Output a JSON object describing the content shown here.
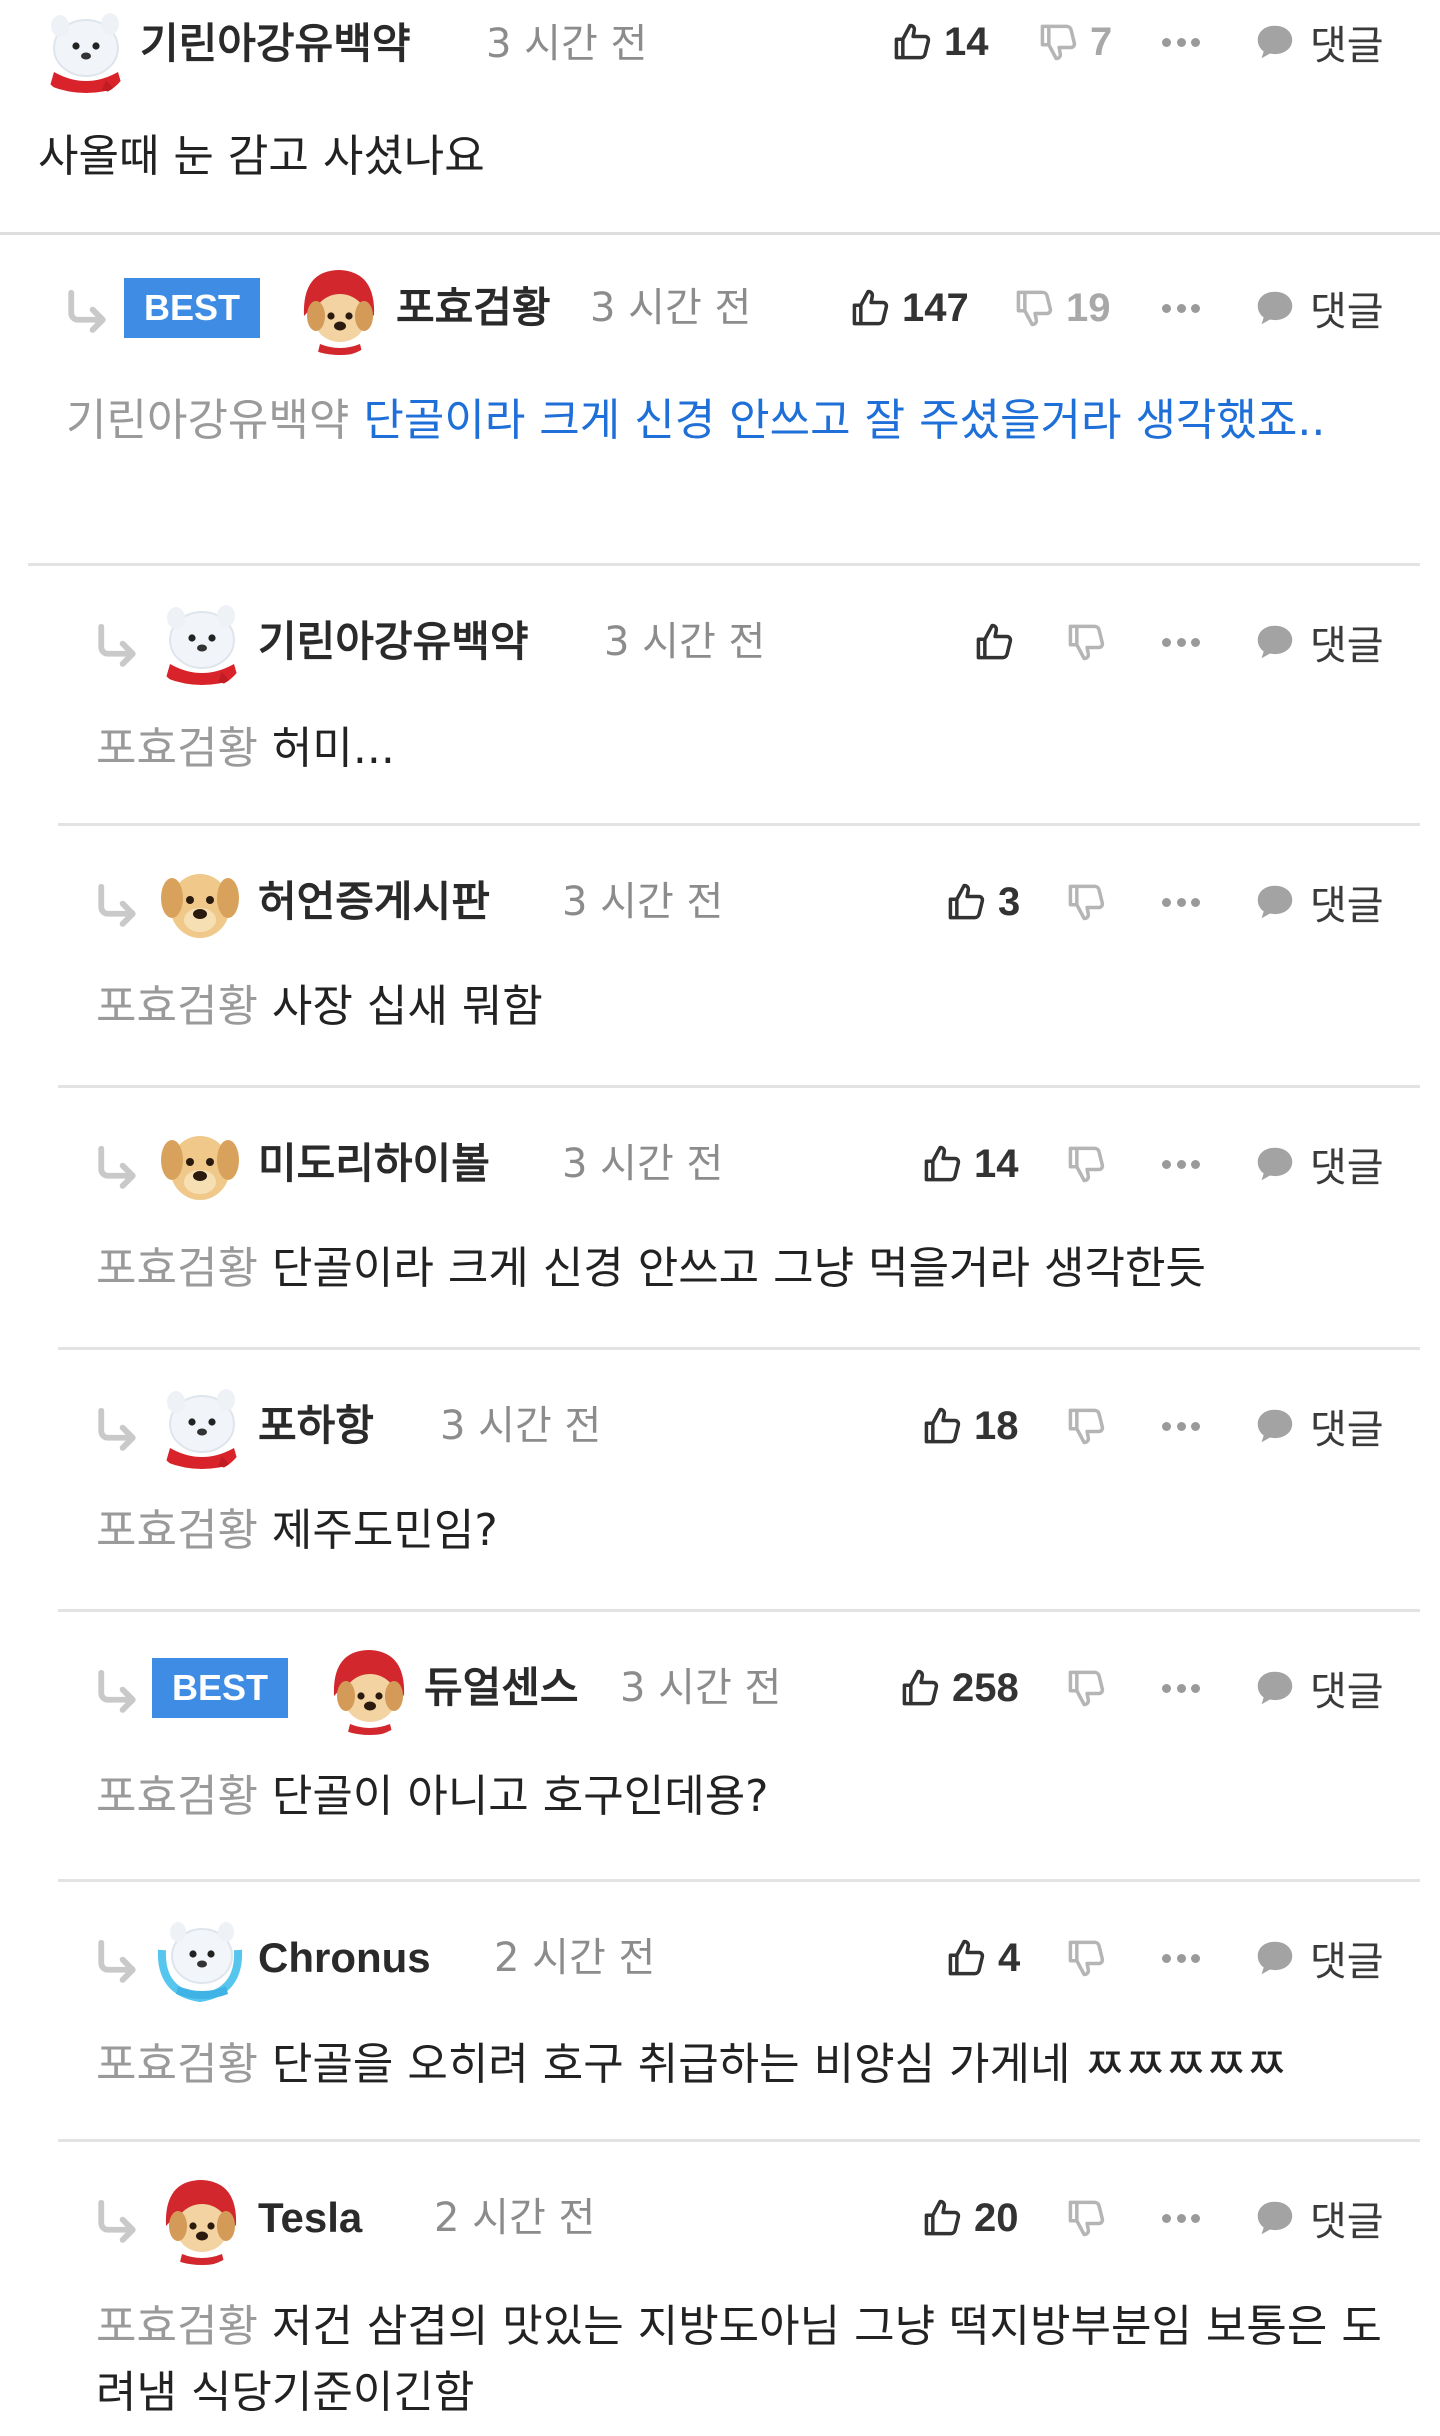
{
  "colors": {
    "best_badge": "#3f8ce5",
    "highlight_text": "#1f6fd9",
    "mention": "#9a9a9a"
  },
  "labels": {
    "reply": "댓글",
    "best": "BEST"
  },
  "comments": [
    {
      "nick": "기린아강유백약",
      "time": "3 시간 전",
      "likes": "14",
      "dislikes": "7",
      "mention": "",
      "text": "사올때 눈 감고 사셨나요",
      "avatar": "white-dog"
    },
    {
      "nick": "포효검황",
      "time": "3 시간 전",
      "likes": "147",
      "dislikes": "19",
      "mention": "기린아강유백약",
      "text": "단골이라 크게 신경 안쓰고 잘 주셨을거라 생각했죠..",
      "avatar": "red-hood-dog",
      "best": true
    },
    {
      "nick": "기린아강유백약",
      "time": "3 시간 전",
      "likes": "",
      "dislikes": "",
      "mention": "포효검황",
      "text": "허미...",
      "avatar": "white-dog"
    },
    {
      "nick": "허언증게시판",
      "time": "3 시간 전",
      "likes": "3",
      "dislikes": "",
      "mention": "포효검황",
      "text": "사장 십새 뭐함",
      "avatar": "puppy"
    },
    {
      "nick": "미도리하이볼",
      "time": "3 시간 전",
      "likes": "14",
      "dislikes": "",
      "mention": "포효검황",
      "text": "단골이라 크게 신경 안쓰고 그냥 먹을거라 생각한듯",
      "avatar": "puppy"
    },
    {
      "nick": "포하항",
      "time": "3 시간 전",
      "likes": "18",
      "dislikes": "",
      "mention": "포효검황",
      "text": "제주도민임?",
      "avatar": "white-dog"
    },
    {
      "nick": "듀얼센스",
      "time": "3 시간 전",
      "likes": "258",
      "dislikes": "",
      "mention": "포효검황",
      "text": "단골이 아니고 호구인데용?",
      "avatar": "red-hood-dog",
      "best": true
    },
    {
      "nick": "Chronus",
      "time": "2 시간 전",
      "likes": "4",
      "dislikes": "",
      "mention": "포효검황",
      "text": "단골을 오히려 호구 취급하는 비양심 가게네 ㅉㅉㅉㅉㅉ",
      "avatar": "blue-dog"
    },
    {
      "nick": "Tesla",
      "time": "2 시간 전",
      "likes": "20",
      "dislikes": "",
      "mention": "포효검황",
      "text": "저건 삼겹의 맛있는 지방도아님 그냥 떡지방부분임 보통은 도려냄 식당기준이긴함",
      "avatar": "red-hood-dog"
    }
  ]
}
